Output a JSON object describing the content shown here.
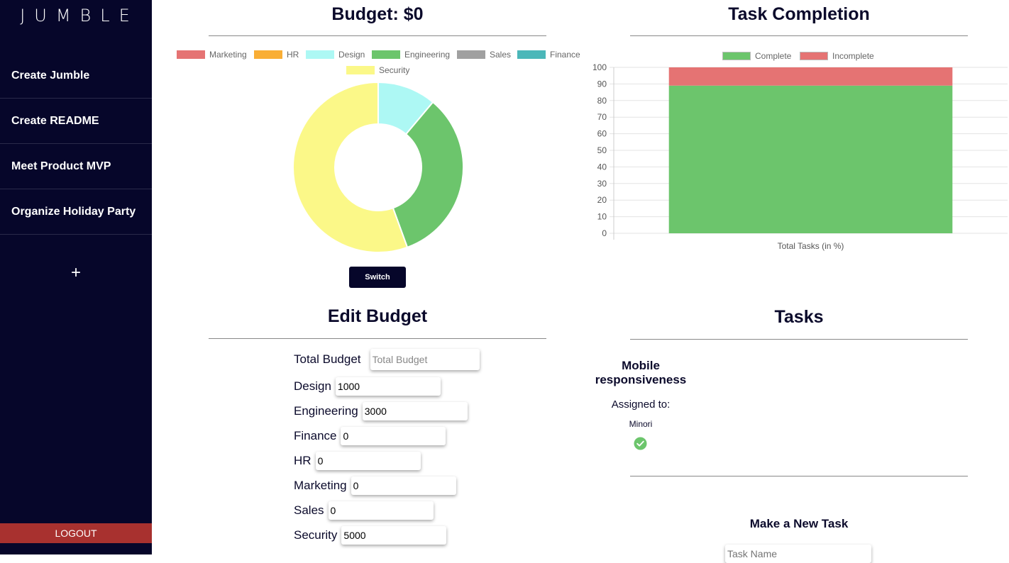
{
  "sidebar": {
    "logo": "JUMBLE",
    "items": [
      {
        "label": "Create Jumble"
      },
      {
        "label": "Create README"
      },
      {
        "label": "Meet Product MVP"
      },
      {
        "label": "Organize Holiday Party"
      }
    ],
    "add_label": "+",
    "logout_label": "LOGOUT"
  },
  "budget_chart": {
    "title": "Budget: $0",
    "switch_label": "Switch"
  },
  "task_chart": {
    "title": "Task Completion"
  },
  "edit_budget": {
    "title": "Edit Budget",
    "total_label": "Total Budget",
    "total_placeholder": "Total Budget",
    "total_value": "",
    "fields": [
      {
        "label": "Design",
        "value": "1000"
      },
      {
        "label": "Engineering",
        "value": "3000"
      },
      {
        "label": "Finance",
        "value": "0"
      },
      {
        "label": "HR",
        "value": "0"
      },
      {
        "label": "Marketing",
        "value": "0"
      },
      {
        "label": "Sales",
        "value": "0"
      },
      {
        "label": "Security",
        "value": "5000"
      }
    ]
  },
  "tasks": {
    "title": "Tasks",
    "items": [
      {
        "name": "Mobile responsiveness",
        "assigned_label": "Assigned to:",
        "assignee": "Minori",
        "status_icon": "check-circle-icon"
      }
    ],
    "new_task_title": "Make a New Task",
    "task_name_placeholder": "Task Name"
  },
  "colors": {
    "sidebar_bg": "#06062a",
    "logout_bg": "#a8312f",
    "complete": "#6cc56c",
    "incomplete": "#e57373"
  },
  "chart_data": [
    {
      "type": "pie",
      "variant": "doughnut",
      "legend_position": "top",
      "categories": [
        "Marketing",
        "HR",
        "Design",
        "Engineering",
        "Sales",
        "Finance",
        "Security"
      ],
      "values": [
        0,
        0,
        1000,
        3000,
        0,
        0,
        5000
      ],
      "colors": [
        "#e57373",
        "#f9ae35",
        "#adf8f4",
        "#6cc56c",
        "#a0a0a0",
        "#4bb7b9",
        "#fbf888"
      ]
    },
    {
      "type": "bar",
      "stacked": true,
      "legend_position": "top",
      "categories": [
        "Total Tasks (in %)"
      ],
      "series": [
        {
          "name": "Complete",
          "values": [
            89
          ],
          "color": "#6cc56c"
        },
        {
          "name": "Incomplete",
          "values": [
            11
          ],
          "color": "#e57373"
        }
      ],
      "ylim": [
        0,
        100
      ],
      "yticks": [
        "0",
        "10",
        "20",
        "30",
        "40",
        "50",
        "60",
        "70",
        "80",
        "90",
        "100"
      ],
      "grid": true
    }
  ]
}
